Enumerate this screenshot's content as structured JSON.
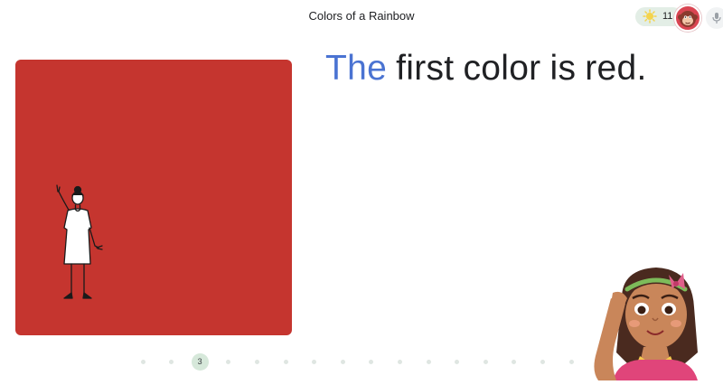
{
  "header": {
    "title": "Colors of a Rainbow",
    "stars_count": "11",
    "star_icon": "star-icon",
    "avatar_icon": "monkey-avatar-icon",
    "mic_icon": "microphone-icon"
  },
  "lesson": {
    "card_color": "#c5352f",
    "sentence_words": [
      "The",
      "first",
      "color",
      "is",
      "red."
    ],
    "highlighted_word": "The",
    "highlight_color": "#4a73d2"
  },
  "progress": {
    "current_page": "3",
    "total_dots": 16
  },
  "characters": {
    "reader": "girl-with-headband-icon",
    "illustration": "woman-pointing-up-icon"
  }
}
